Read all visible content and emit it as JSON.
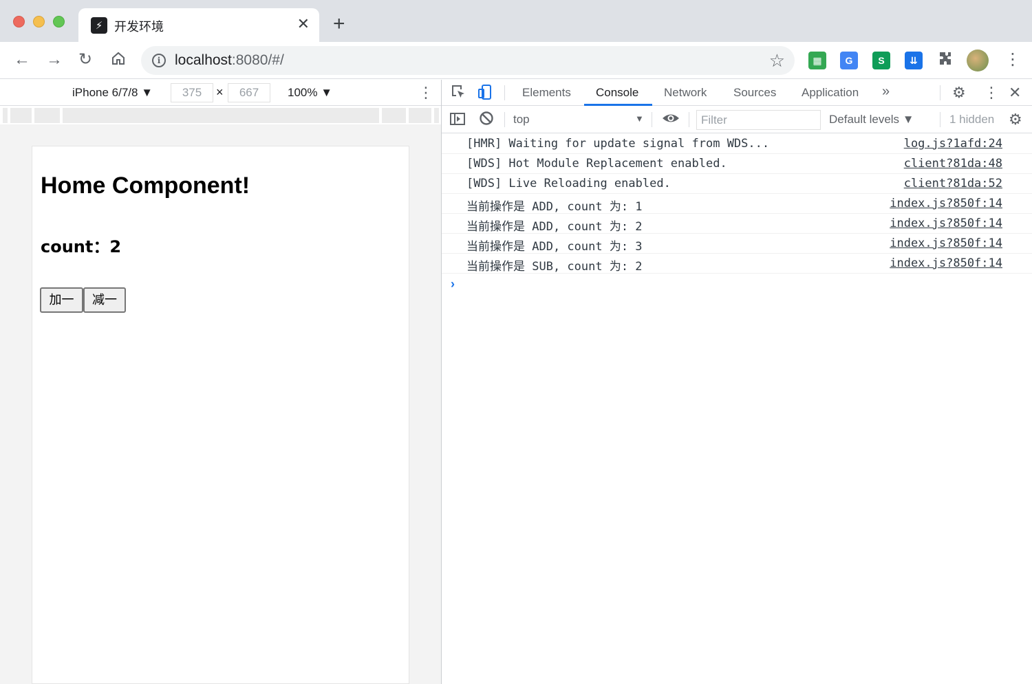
{
  "browser": {
    "tab_title": "开发环境",
    "url_host": "localhost",
    "url_path": ":8080/#/"
  },
  "device_toolbar": {
    "device": "iPhone 6/7/8 ▼",
    "width": "375",
    "height": "667",
    "times": "×",
    "zoom": "100% ▼"
  },
  "page": {
    "title": "Home Component!",
    "count_label": "count：2",
    "add_button": "加一",
    "sub_button": "减一"
  },
  "devtools": {
    "tabs": [
      {
        "label": "Elements"
      },
      {
        "label": "Console"
      },
      {
        "label": "Network"
      },
      {
        "label": "Sources"
      },
      {
        "label": "Application"
      }
    ],
    "active_tab": "Console",
    "context": "top",
    "filter_placeholder": "Filter",
    "levels": "Default levels ▼",
    "hidden": "1 hidden",
    "accent_color": "#1a73e8"
  },
  "console": {
    "logs": [
      {
        "msg": "[HMR] Waiting for update signal from WDS...",
        "src": "log.js?1afd:24"
      },
      {
        "msg": "[WDS] Hot Module Replacement enabled.",
        "src": "client?81da:48"
      },
      {
        "msg": "[WDS] Live Reloading enabled.",
        "src": "client?81da:52"
      },
      {
        "msg": "当前操作是 ADD, count 为: 1",
        "src": "index.js?850f:14"
      },
      {
        "msg": "当前操作是 ADD, count 为: 2",
        "src": "index.js?850f:14"
      },
      {
        "msg": "当前操作是 ADD, count 为: 3",
        "src": "index.js?850f:14"
      },
      {
        "msg": "当前操作是 SUB, count 为: 2",
        "src": "index.js?850f:14"
      }
    ],
    "prompt": "›"
  }
}
